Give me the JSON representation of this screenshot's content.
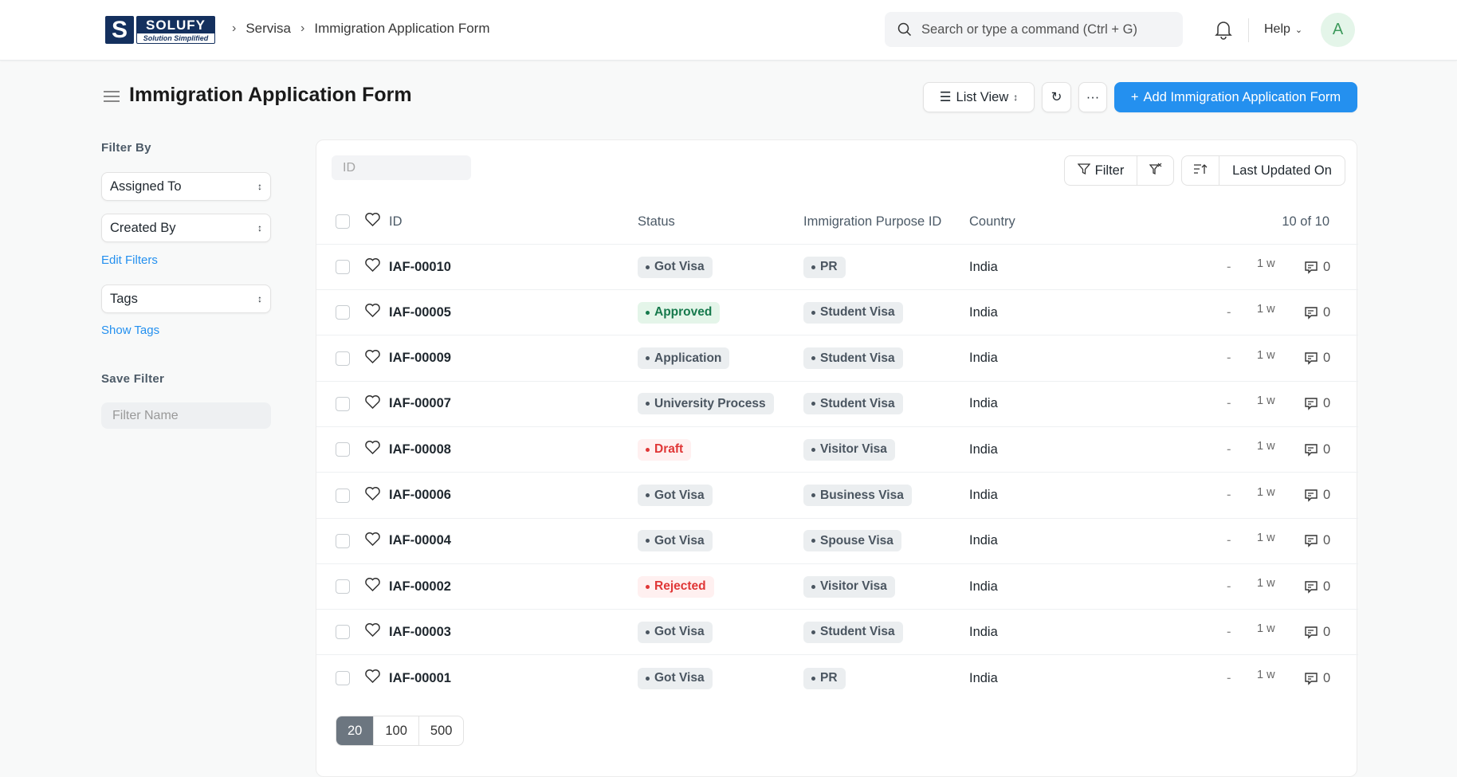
{
  "topbar": {
    "logo_text": "SOLUFY",
    "logo_tagline": "Solution Simplified",
    "breadcrumbs": [
      "Servisa",
      "Immigration Application Form"
    ],
    "search_placeholder": "Search or type a command (Ctrl + G)",
    "help_label": "Help",
    "avatar_initial": "A"
  },
  "page": {
    "title": "Immigration Application Form",
    "view_label": "List View",
    "add_label": "Add Immigration Application Form",
    "accent": "#2490ef"
  },
  "sidebar": {
    "filter_by": "Filter By",
    "filters": [
      "Assigned To",
      "Created By"
    ],
    "edit_filters": "Edit Filters",
    "tags": "Tags",
    "show_tags": "Show Tags",
    "save_filter": "Save Filter",
    "filter_name_placeholder": "Filter Name"
  },
  "list": {
    "id_placeholder": "ID",
    "filter_label": "Filter",
    "sort_label": "Last Updated On",
    "columns": {
      "id": "ID",
      "status": "Status",
      "purpose": "Immigration Purpose ID",
      "country": "Country"
    },
    "count": "10 of 10",
    "rows": [
      {
        "id": "IAF-00010",
        "status": "Got Visa",
        "tone": "gray",
        "purpose": "PR",
        "country": "India",
        "assigned": "-",
        "modified": "1 w",
        "comments": "0"
      },
      {
        "id": "IAF-00005",
        "status": "Approved",
        "tone": "green",
        "purpose": "Student Visa",
        "country": "India",
        "assigned": "-",
        "modified": "1 w",
        "comments": "0"
      },
      {
        "id": "IAF-00009",
        "status": "Application",
        "tone": "gray",
        "purpose": "Student Visa",
        "country": "India",
        "assigned": "-",
        "modified": "1 w",
        "comments": "0"
      },
      {
        "id": "IAF-00007",
        "status": "University Process",
        "tone": "gray",
        "purpose": "Student Visa",
        "country": "India",
        "assigned": "-",
        "modified": "1 w",
        "comments": "0"
      },
      {
        "id": "IAF-00008",
        "status": "Draft",
        "tone": "red",
        "purpose": "Visitor Visa",
        "country": "India",
        "assigned": "-",
        "modified": "1 w",
        "comments": "0"
      },
      {
        "id": "IAF-00006",
        "status": "Got Visa",
        "tone": "gray",
        "purpose": "Business Visa",
        "country": "India",
        "assigned": "-",
        "modified": "1 w",
        "comments": "0"
      },
      {
        "id": "IAF-00004",
        "status": "Got Visa",
        "tone": "gray",
        "purpose": "Spouse Visa",
        "country": "India",
        "assigned": "-",
        "modified": "1 w",
        "comments": "0"
      },
      {
        "id": "IAF-00002",
        "status": "Rejected",
        "tone": "red",
        "purpose": "Visitor Visa",
        "country": "India",
        "assigned": "-",
        "modified": "1 w",
        "comments": "0"
      },
      {
        "id": "IAF-00003",
        "status": "Got Visa",
        "tone": "gray",
        "purpose": "Student Visa",
        "country": "India",
        "assigned": "-",
        "modified": "1 w",
        "comments": "0"
      },
      {
        "id": "IAF-00001",
        "status": "Got Visa",
        "tone": "gray",
        "purpose": "PR",
        "country": "India",
        "assigned": "-",
        "modified": "1 w",
        "comments": "0"
      }
    ],
    "page_sizes": [
      "20",
      "100",
      "500"
    ],
    "selected_page_size": "20"
  }
}
